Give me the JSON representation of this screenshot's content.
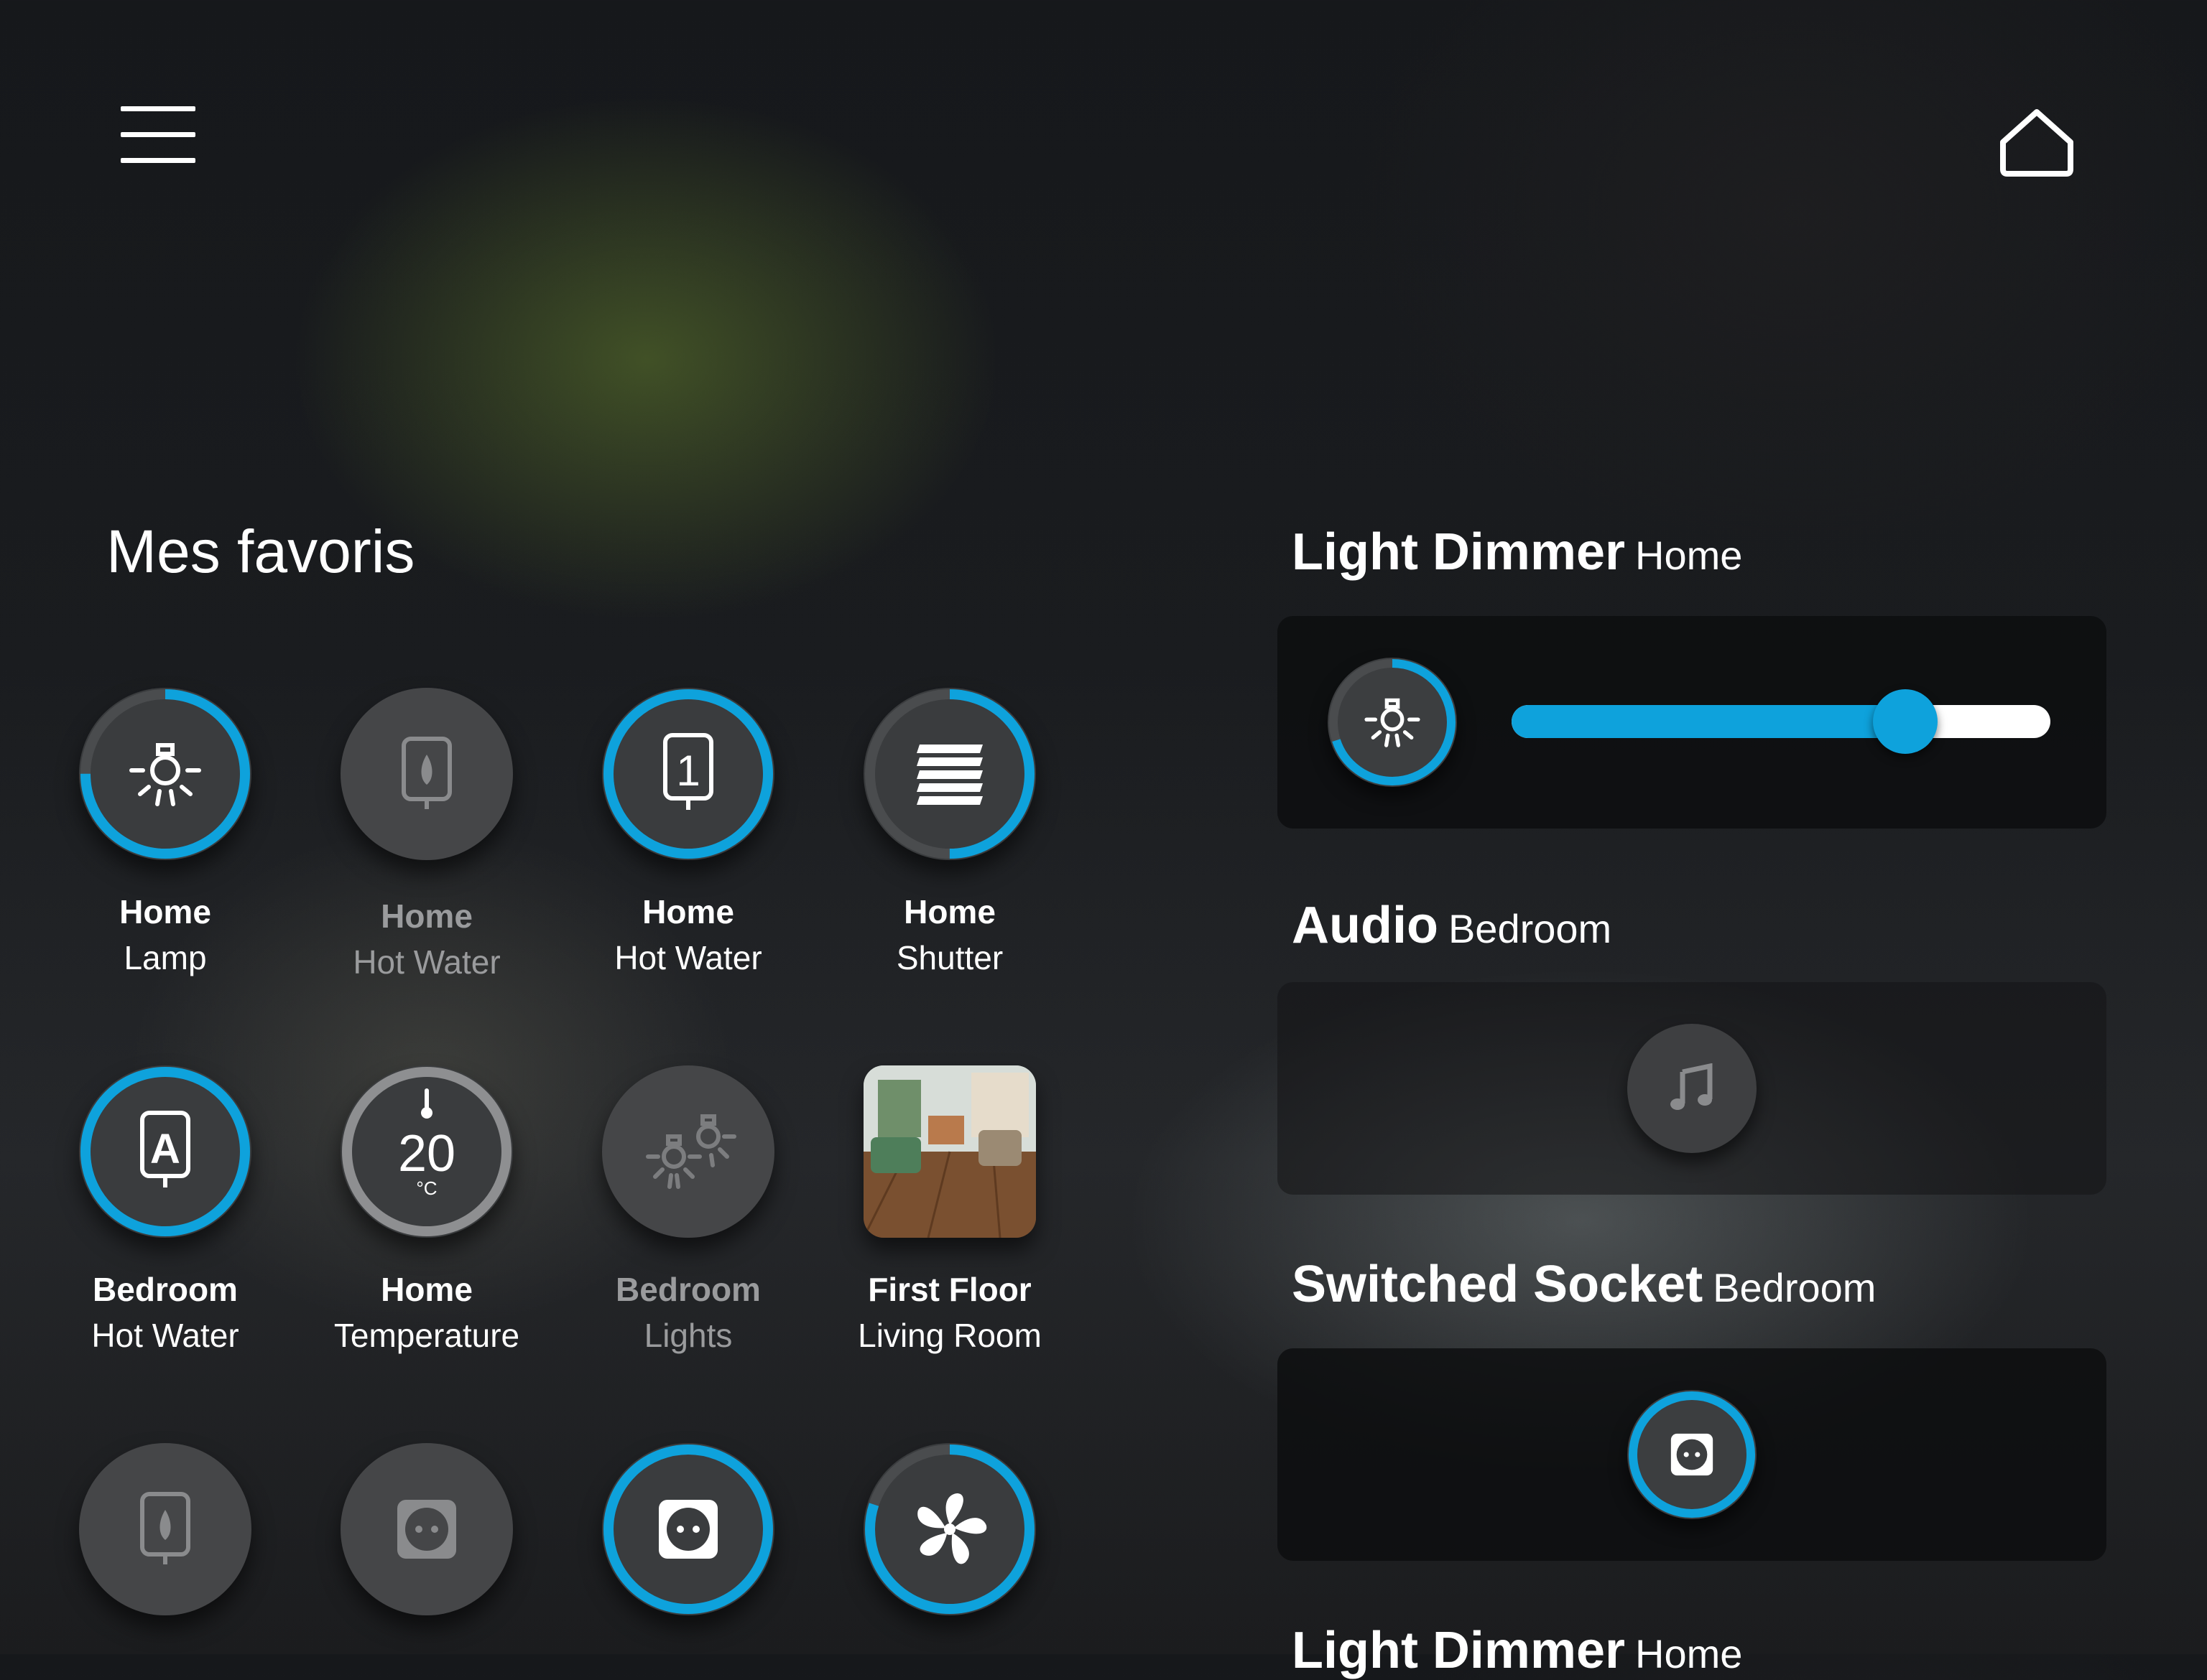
{
  "header": {
    "menu_icon": "hamburger-menu-icon",
    "home_icon": "home-icon"
  },
  "favorites": {
    "title": "Mes favoris",
    "accent_color": "#0ea2dc",
    "tiles": [
      {
        "line1": "Home",
        "line2": "Lamp",
        "icon": "light-bulb-icon",
        "state": "on",
        "progress": 0.75
      },
      {
        "line1": "Home",
        "line2": "Hot Water",
        "icon": "water-heater-flame-icon",
        "state": "off",
        "progress": 0
      },
      {
        "line1": "Home",
        "line2": "Hot Water",
        "icon": "water-heater-1-icon",
        "state": "on",
        "progress": 1.0
      },
      {
        "line1": "Home",
        "line2": "Shutter",
        "icon": "shutter-icon",
        "state": "on",
        "progress": 0.5
      },
      {
        "line1": "Bedroom",
        "line2": "Hot Water",
        "icon": "water-heater-a-icon",
        "state": "on",
        "progress": 1.0
      },
      {
        "line1": "Home",
        "line2": "Temperature",
        "icon": "thermometer-icon",
        "state": "neutral",
        "value": "20",
        "unit": "°C"
      },
      {
        "line1": "Bedroom",
        "line2": "Lights",
        "icon": "lights-group-icon",
        "state": "off",
        "progress": 0
      },
      {
        "line1": "First Floor",
        "line2": "Living Room",
        "icon": "living-room-photo",
        "state": "photo"
      },
      {
        "icon": "water-heater-flame-icon",
        "state": "off",
        "progress": 0
      },
      {
        "icon": "socket-icon",
        "state": "off",
        "progress": 0
      },
      {
        "icon": "socket-icon",
        "state": "on",
        "progress": 1.0
      },
      {
        "icon": "fan-icon",
        "state": "on",
        "progress": 0.8
      }
    ]
  },
  "widgets": {
    "light_dimmer": {
      "title": "Light Dimmer",
      "room": "Home",
      "level": 0.73,
      "icon": "light-bulb-icon",
      "progress": 0.7
    },
    "audio": {
      "title": "Audio",
      "room": "Bedroom",
      "icon": "music-note-icon"
    },
    "switched_socket": {
      "title": "Switched Socket",
      "room": "Bedroom",
      "icon": "socket-icon"
    },
    "light_dimmer_2": {
      "title": "Light Dimmer",
      "room": "Home"
    }
  }
}
